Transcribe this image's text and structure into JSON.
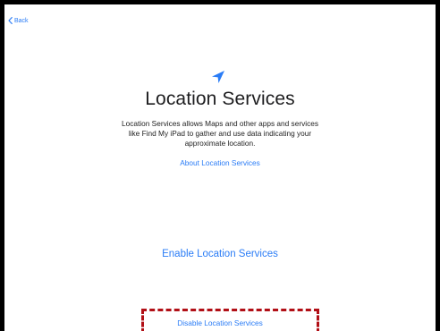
{
  "nav": {
    "back_label": "Back"
  },
  "main": {
    "icon": "location-arrow-icon",
    "title": "Location Services",
    "description": "Location Services allows Maps and other apps and services like Find My iPad to gather and use data indicating your approximate location.",
    "about_link": "About Location Services",
    "enable_button": "Enable Location Services",
    "disable_button": "Disable Location Services"
  },
  "colors": {
    "accent": "#2a7cf6",
    "highlight_box": "#b10f16",
    "title_text": "#1d1d1f"
  }
}
